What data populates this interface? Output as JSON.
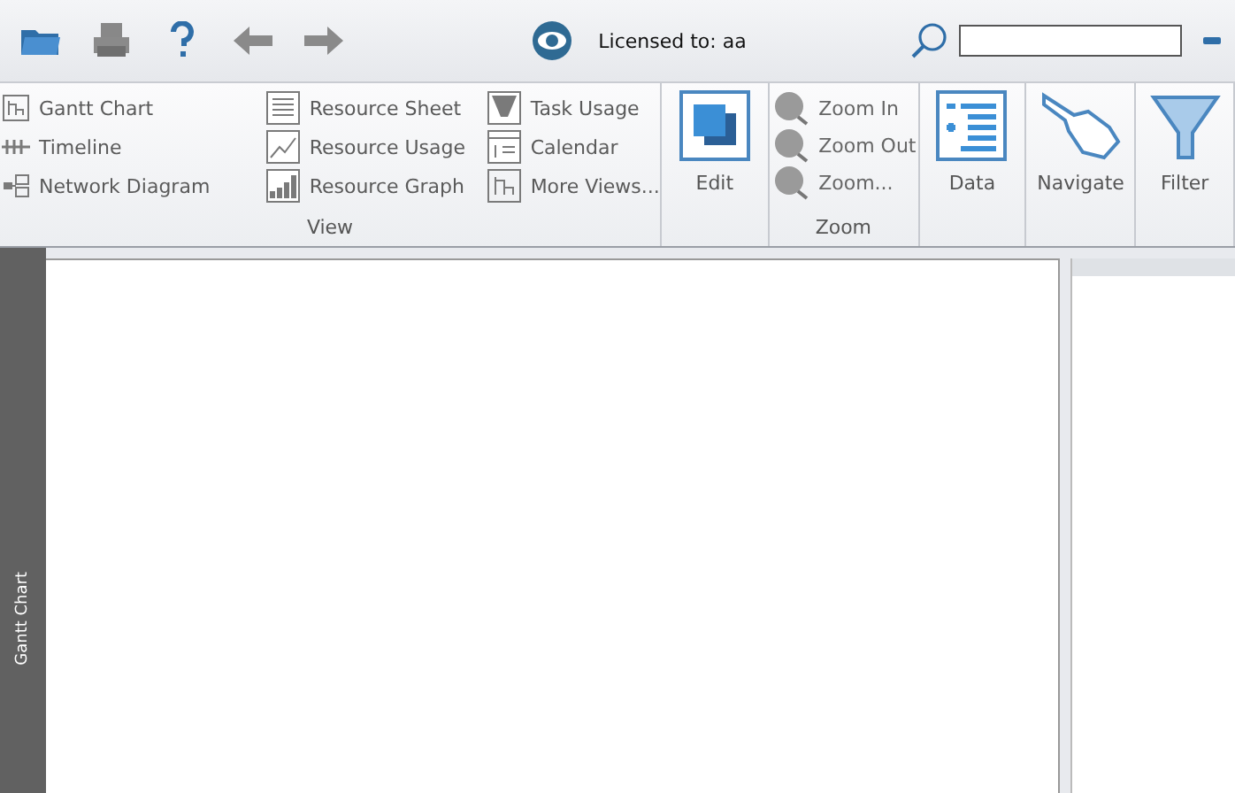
{
  "toolbar": {
    "license_text": "Licensed to: aa"
  },
  "ribbon": {
    "view_group": {
      "label": "View",
      "columns": [
        [
          {
            "label": "Gantt Chart"
          },
          {
            "label": "Timeline"
          },
          {
            "label": "Network Diagram"
          }
        ],
        [
          {
            "label": "Resource Sheet"
          },
          {
            "label": "Resource Usage"
          },
          {
            "label": "Resource Graph"
          }
        ],
        [
          {
            "label": "Task Usage"
          },
          {
            "label": "Calendar"
          },
          {
            "label": "More Views..."
          }
        ]
      ]
    },
    "edit": {
      "label": "Edit"
    },
    "zoom_group": {
      "label": "Zoom",
      "items": [
        {
          "label": "Zoom In",
          "disabled": true
        },
        {
          "label": "Zoom Out",
          "disabled": true
        },
        {
          "label": "Zoom...",
          "disabled": true
        }
      ]
    },
    "data": {
      "label": "Data"
    },
    "navigate": {
      "label": "Navigate"
    },
    "filter": {
      "label": "Filter"
    }
  },
  "side_tab": {
    "label": "Gantt Chart"
  }
}
